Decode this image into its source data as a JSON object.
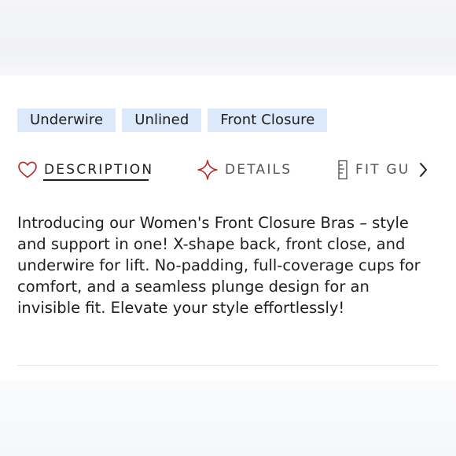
{
  "tags": [
    "Underwire",
    "Unlined",
    "Front Closure"
  ],
  "tabs": {
    "description": "DESCRIPTION",
    "details": "DETAILS",
    "fit_guide": "FIT GU"
  },
  "description_text": "Introducing our Women's Front Closure Bras – style and support in one! X-shape back, front close, and underwire for lift. No-padding, full-coverage cups for comfort, and a seamless plunge design for an invisible fit. Elevate your style effortlessly!",
  "icons": {
    "description": "heart-icon",
    "details": "sparkle-icon",
    "fit_guide": "ruler-icon",
    "scroll": "chevron-right-icon"
  },
  "colors": {
    "tag_background": "#dce9fa",
    "icon_accent": "#b5252a",
    "text": "#1e1e1e"
  }
}
